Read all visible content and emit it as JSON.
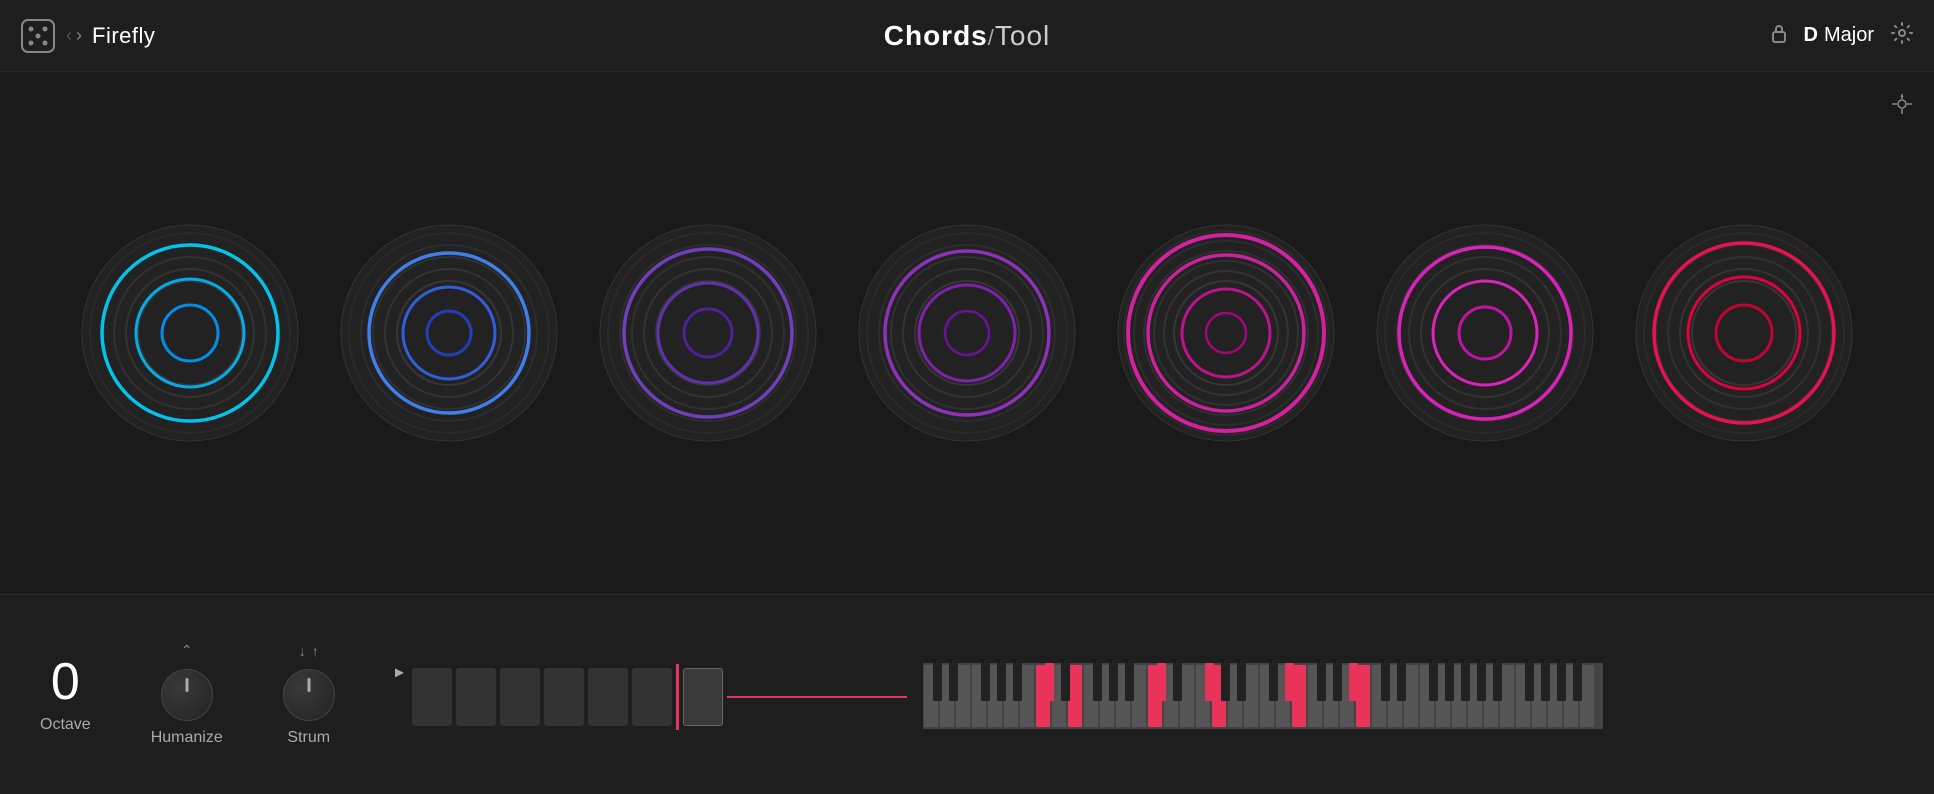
{
  "header": {
    "preset_name": "Firefly",
    "app_title_bold": "Chords",
    "app_title_slash": "/",
    "app_title_light": "Tool",
    "key_note": "D",
    "key_scale": "Major",
    "lock_label": "🔒",
    "settings_label": "⚙"
  },
  "controls": {
    "octave_label": "Octave",
    "octave_value": "0",
    "humanize_label": "Humanize",
    "strum_label": "Strum"
  },
  "chord_circles": [
    {
      "color": "#00d4ff",
      "inner_color": "#00aaff",
      "size": 230,
      "rings": 6
    },
    {
      "color": "#4488ff",
      "inner_color": "#3366ee",
      "size": 230,
      "rings": 6
    },
    {
      "color": "#7744cc",
      "inner_color": "#6633bb",
      "size": 230,
      "rings": 6
    },
    {
      "color": "#9933cc",
      "inner_color": "#8822bb",
      "size": 230,
      "rings": 6
    },
    {
      "color": "#dd22aa",
      "inner_color": "#cc1199",
      "size": 230,
      "rings": 7
    },
    {
      "color": "#ee22cc",
      "inner_color": "#dd11bb",
      "size": 230,
      "rings": 6
    },
    {
      "color": "#ff1155",
      "inner_color": "#ee0044",
      "size": 230,
      "rings": 6
    }
  ],
  "sequencer": {
    "blocks": 7,
    "active_block": 6,
    "play_icon": "▶"
  },
  "piano": {
    "active_keys": [
      3,
      5,
      8,
      11,
      14,
      17,
      19,
      22
    ]
  }
}
